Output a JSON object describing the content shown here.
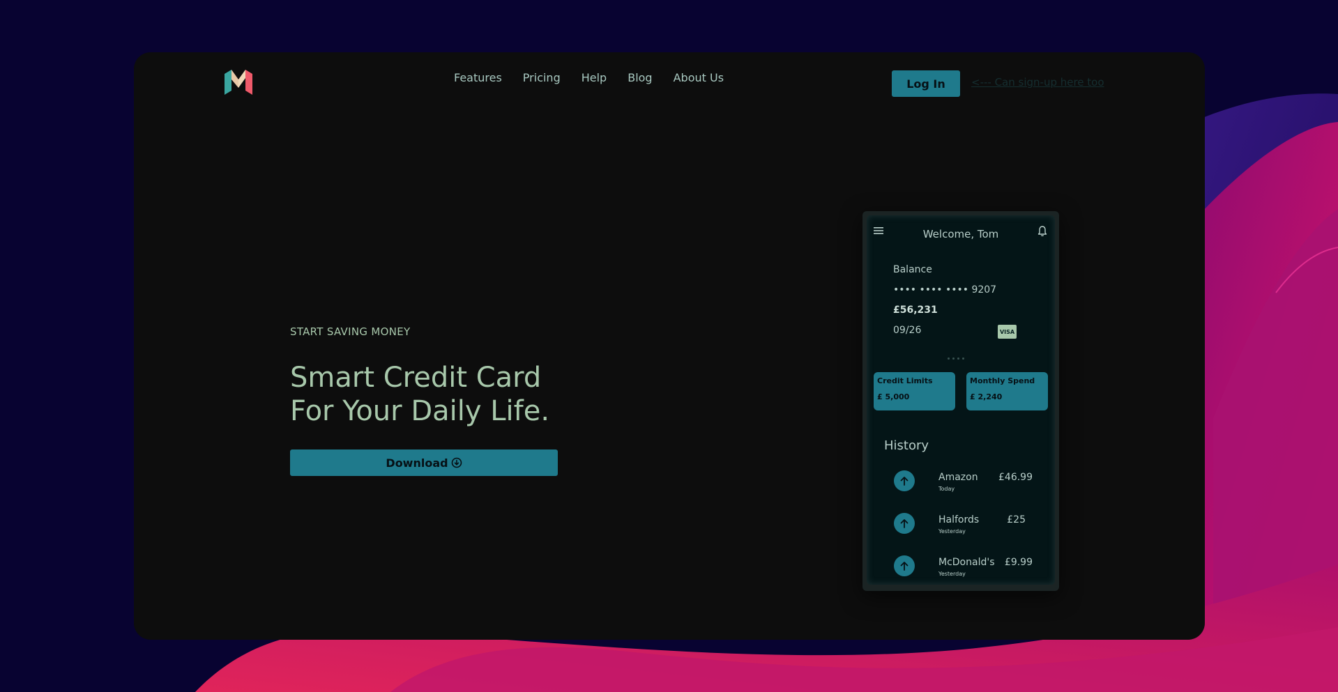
{
  "nav": {
    "logo_icon": "m-logo-icon",
    "links": [
      "Features",
      "Pricing",
      "Help",
      "Blog",
      "About Us"
    ],
    "login_label": "Log In",
    "signup_text": "<--- Can sign-up here too"
  },
  "hero": {
    "eyebrow": "START SAVING MONEY",
    "headline_line1": "Smart Credit Card",
    "headline_line2": "For Your Daily Life.",
    "download_label": "Download",
    "download_icon": "download-circle-icon"
  },
  "phone": {
    "welcome": "Welcome, Tom",
    "menu_icon": "hamburger-menu-icon",
    "bell_icon": "bell-icon",
    "balance_label": "Balance",
    "card_number": "•••• •••• •••• 9207",
    "balance_amount": "£56,231",
    "expiry": "09/26",
    "card_brand": "VISA",
    "credit_limits_label": "Credit Limits",
    "credit_limits_value": "£ 5,000",
    "monthly_spend_label": "Monthly Spend",
    "monthly_spend_value": "£ 2,240",
    "history_title": "History",
    "history": [
      {
        "name": "Amazon",
        "date": "Today",
        "amount": "£46.99"
      },
      {
        "name": "Halfords",
        "date": "Yesterday",
        "amount": "£25"
      },
      {
        "name": "McDonald's",
        "date": "Yesterday",
        "amount": "£9.99"
      }
    ]
  },
  "colors": {
    "background": "#080331",
    "frame": "#0d0d0d",
    "accent": "#1f7a8c",
    "text_mint": "#a8c8ab",
    "wave_magenta": "#c2186a",
    "wave_purple": "#3a1a8a"
  }
}
